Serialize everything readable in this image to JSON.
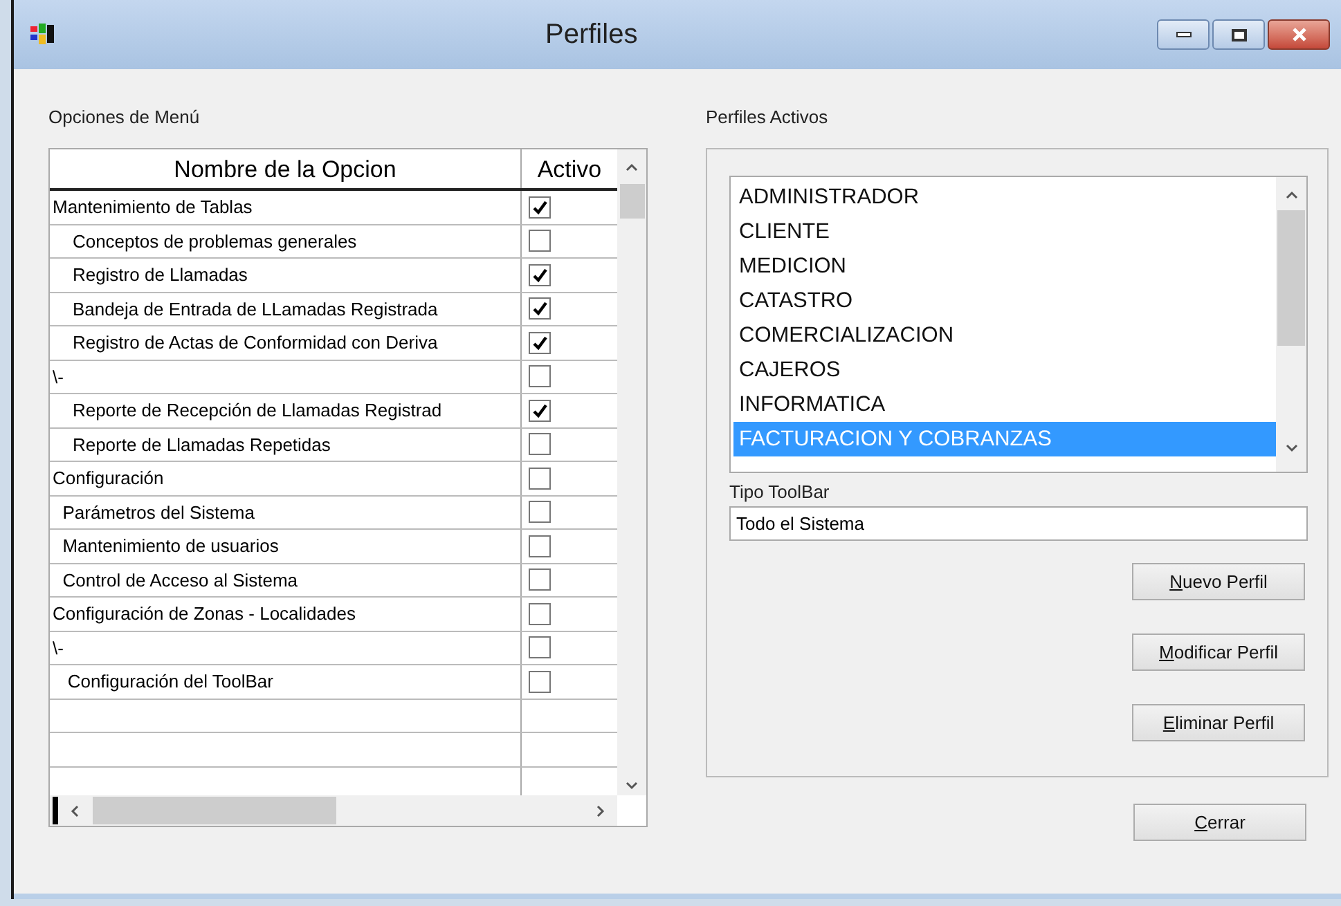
{
  "window": {
    "title": "Perfiles"
  },
  "menu_options": {
    "label": "Opciones de Menú",
    "columns": [
      "Nombre de la Opcion",
      "Activo"
    ],
    "rows": [
      {
        "name": "Mantenimiento de Tablas",
        "checked": true
      },
      {
        "name": "    Conceptos de problemas generales",
        "checked": false
      },
      {
        "name": "    Registro de Llamadas",
        "checked": true
      },
      {
        "name": "    Bandeja de Entrada de LLamadas Registrada",
        "checked": true
      },
      {
        "name": "    Registro de Actas de Conformidad con Deriva",
        "checked": true
      },
      {
        "name": "\\-",
        "checked": false
      },
      {
        "name": "    Reporte de Recepción de Llamadas Registrad",
        "checked": true
      },
      {
        "name": "    Reporte de Llamadas Repetidas",
        "checked": false
      },
      {
        "name": "Configuración",
        "checked": false
      },
      {
        "name": "  Parámetros del Sistema",
        "checked": false
      },
      {
        "name": "  Mantenimiento de usuarios",
        "checked": false
      },
      {
        "name": "  Control de Acceso al Sistema",
        "checked": false
      },
      {
        "name": "Configuración de Zonas - Localidades",
        "checked": false
      },
      {
        "name": "\\-",
        "checked": false
      },
      {
        "name": "   Configuración del ToolBar",
        "checked": false
      }
    ]
  },
  "profiles": {
    "label": "Perfiles Activos",
    "items": [
      {
        "label": "ADMINISTRADOR",
        "selected": false
      },
      {
        "label": "CLIENTE",
        "selected": false
      },
      {
        "label": "MEDICION",
        "selected": false
      },
      {
        "label": "CATASTRO",
        "selected": false
      },
      {
        "label": "COMERCIALIZACION",
        "selected": false
      },
      {
        "label": "CAJEROS",
        "selected": false
      },
      {
        "label": "INFORMATICA",
        "selected": false
      },
      {
        "label": "FACTURACION Y COBRANZAS",
        "selected": true
      }
    ],
    "toolbar_type": {
      "label": "Tipo ToolBar",
      "value": "Todo el Sistema"
    },
    "buttons": [
      {
        "label": "Nuevo Perfil",
        "mnemonic": true
      },
      {
        "label": "Modificar Perfil",
        "mnemonic": true
      },
      {
        "label": "Eliminar Perfil",
        "mnemonic": true
      }
    ]
  },
  "close_button": {
    "label": "Cerrar",
    "mnemonic": true
  }
}
